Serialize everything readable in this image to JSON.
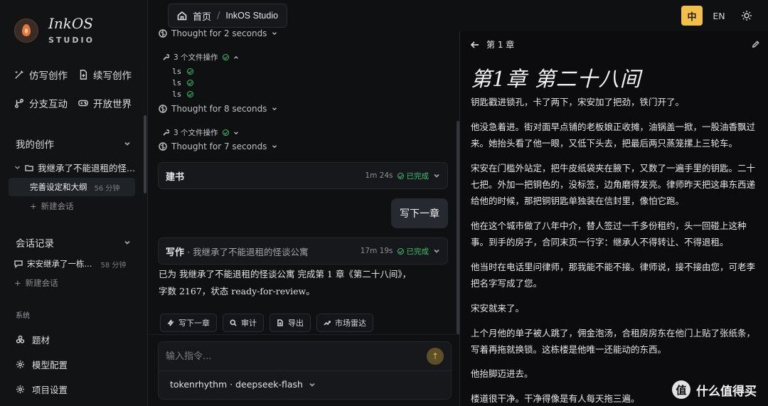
{
  "brand": {
    "name": "InkOS",
    "sub": "STUDIO"
  },
  "nav": [
    {
      "label": "仿写创作",
      "icon": "pen-sparkle-icon"
    },
    {
      "label": "续写创作",
      "icon": "document-plus-icon"
    },
    {
      "label": "分支互动",
      "icon": "branch-icon"
    },
    {
      "label": "开放世界",
      "icon": "gamepad-icon"
    }
  ],
  "works": {
    "title": "我的创作",
    "book": "我继承了不能退租的怪...",
    "session": {
      "label": "完善设定和大纲",
      "age": "56 分钟"
    },
    "new_session": "新建会话"
  },
  "history": {
    "title": "会话记录",
    "item": {
      "label": "宋安继承了一栋...",
      "age": "58 分钟"
    },
    "new_session": "新建会话"
  },
  "system": {
    "label": "系统",
    "items": [
      {
        "label": "题材",
        "icon": "layers-icon"
      },
      {
        "label": "模型配置",
        "icon": "gear-icon"
      },
      {
        "label": "项目设置",
        "icon": "gear-icon"
      }
    ]
  },
  "breadcrumb": {
    "home": "首页",
    "sep": "/",
    "current": "InkOS Studio"
  },
  "lang": {
    "zh": "中",
    "en": "EN"
  },
  "chat": {
    "thought1": "Thought for 2 seconds",
    "fileops1": "3 个文件操作",
    "cmds": [
      "ls",
      "ls",
      "ls"
    ],
    "thought2": "Thought for 8 seconds",
    "fileops2": "3 个文件操作",
    "thought3": "Thought for 7 seconds",
    "card1": {
      "title": "建书",
      "time": "1m 24s",
      "status": "已完成"
    },
    "user_msg": "写下一章",
    "card2": {
      "title": "写作",
      "sub": "· 我继承了不能退租的怪谈公寓",
      "time": "17m 19s",
      "status": "已完成"
    },
    "result": "已为 我继承了不能退租的怪谈公寓 完成第 1 章《第二十八间》，字数 2167，状态 ready-for-review。",
    "actions": [
      {
        "label": "写下一章",
        "icon": "zap-icon"
      },
      {
        "label": "审计",
        "icon": "search-icon"
      },
      {
        "label": "导出",
        "icon": "export-icon"
      },
      {
        "label": "市场雷达",
        "icon": "trend-icon"
      }
    ],
    "input_placeholder": "输入指令...",
    "model": "tokenrhythm · deepseek-flash"
  },
  "reader": {
    "header": "第 1 章",
    "title": "第1章 第二十八间",
    "paragraphs": [
      "钥匙戳进锁孔，卡了两下，宋安加了把劲，铁门开了。",
      "他没急着进。街对面早点铺的老板娘正收摊，油锅盖一掀，一股油香飘过来。她抬头看了他一眼，又低下头去，把最后两只蒸笼摞上三轮车。",
      "宋安在门槛外站定，把牛皮纸袋夹在腋下，又数了一遍手里的钥匙。二十七把。外加一把铜色的，没标签，边角磨得发亮。律师昨天把这串东西递给他的时候，那把铜钥匙单独装在信封里，像怕它跑。",
      "他在这个城市做了八年中介，替人签过一千多份租约，头一回碰上这种事。到手的房子，合同末页一行字：继承人不得转让、不得退租。",
      "他当时在电话里问律师，那我能不能不接。律师说，接不接由您，可老李把名字写成了您。",
      "宋安就来了。",
      "上个月他的单子被人跳了，佣金泡汤，合租房房东在他门上贴了张纸条，写着再拖就换锁。这栋楼是他唯一还能动的东西。",
      "他抬脚迈进去。",
      "楼道很干净。干净得像是有人每天拖三遍。"
    ]
  },
  "watermark": {
    "icon": "值",
    "text": "什么值得买"
  }
}
